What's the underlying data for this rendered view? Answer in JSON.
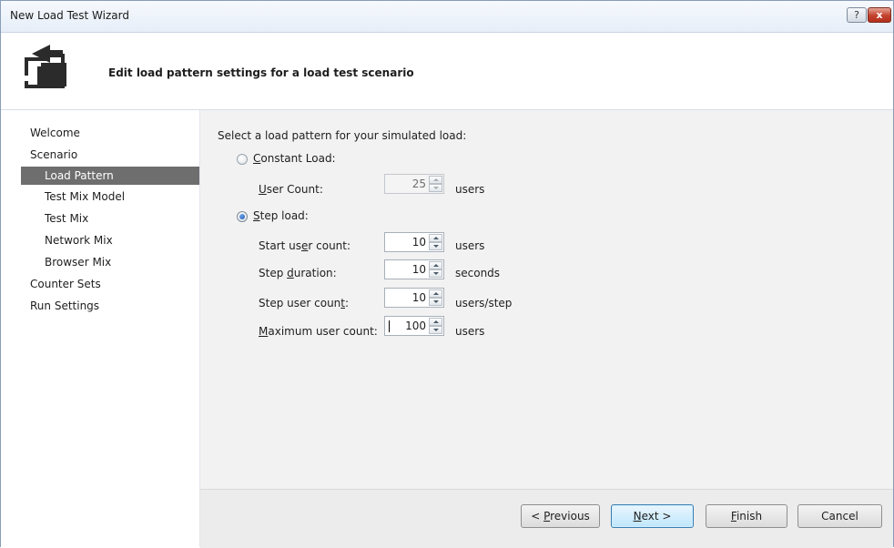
{
  "window": {
    "title": "New Load Test Wizard",
    "help_label": "?",
    "close_label": "x"
  },
  "header": {
    "title": "Edit load pattern settings for a load test scenario"
  },
  "sidebar": {
    "items": [
      {
        "label": "Welcome",
        "level": 0,
        "selected": false
      },
      {
        "label": "Scenario",
        "level": 0,
        "selected": false
      },
      {
        "label": "Load Pattern",
        "level": 1,
        "selected": true
      },
      {
        "label": "Test Mix Model",
        "level": 1,
        "selected": false
      },
      {
        "label": "Test Mix",
        "level": 1,
        "selected": false
      },
      {
        "label": "Network Mix",
        "level": 1,
        "selected": false
      },
      {
        "label": "Browser Mix",
        "level": 1,
        "selected": false
      },
      {
        "label": "Counter Sets",
        "level": 0,
        "selected": false
      },
      {
        "label": "Run Settings",
        "level": 0,
        "selected": false
      }
    ]
  },
  "content": {
    "prompt": "Select a load pattern for your simulated load:",
    "constant_load": {
      "label_pre": "",
      "label_mn": "C",
      "label_post": "onstant Load:",
      "selected": false,
      "user_count": {
        "label_pre": "",
        "label_mn": "U",
        "label_post": "ser Count:",
        "value": "25",
        "unit": "users",
        "enabled": false
      }
    },
    "step_load": {
      "label_pre": "",
      "label_mn": "S",
      "label_post": "tep load:",
      "selected": true,
      "start_user_count": {
        "label_pre": "Start us",
        "label_mn": "e",
        "label_post": "r count:",
        "value": "10",
        "unit": "users"
      },
      "step_duration": {
        "label_pre": "Step ",
        "label_mn": "d",
        "label_post": "uration:",
        "value": "10",
        "unit": "seconds"
      },
      "step_user_count": {
        "label_pre": "Step user coun",
        "label_mn": "t",
        "label_post": ":",
        "value": "10",
        "unit": "users/step"
      },
      "maximum_user_count": {
        "label_pre": "",
        "label_mn": "M",
        "label_post": "aximum user count:",
        "value": "100",
        "unit": "users"
      }
    }
  },
  "footer": {
    "previous": {
      "pre": "< ",
      "mn": "P",
      "post": "revious"
    },
    "next": {
      "pre": "",
      "mn": "N",
      "post": "ext >"
    },
    "finish": {
      "pre": "",
      "mn": "F",
      "post": "inish"
    },
    "cancel": {
      "pre": "Cancel",
      "mn": "",
      "post": ""
    }
  },
  "colors": {
    "selected_nav_bg": "#6e6e6e",
    "content_bg": "#f2f2f2",
    "close_button": "#c3412c"
  },
  "icons": {
    "wizard": "load-test-wizard-icon",
    "help": "help-icon",
    "close": "close-icon"
  }
}
